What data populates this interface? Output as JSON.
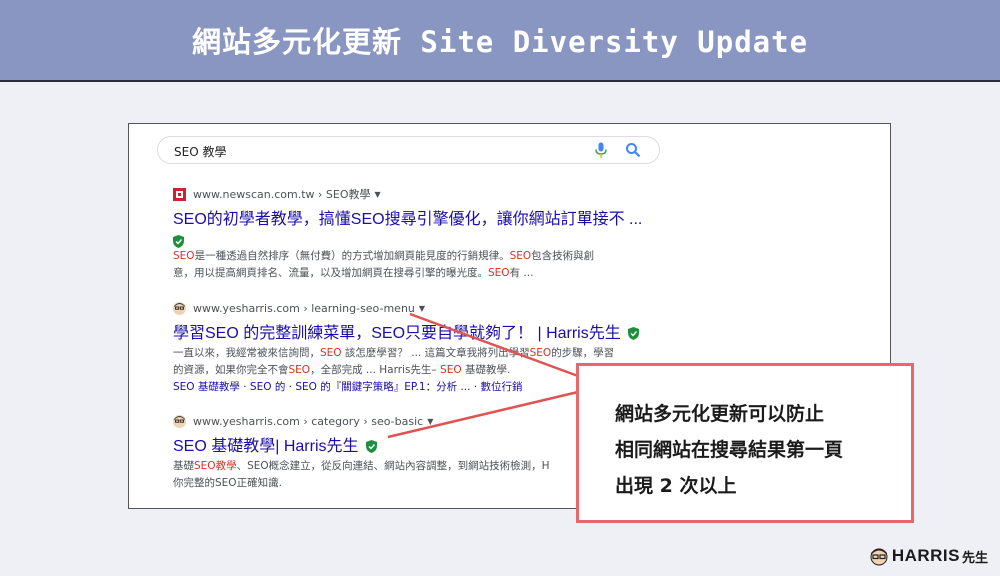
{
  "banner": {
    "title": "網站多元化更新 Site Diversity Update"
  },
  "search": {
    "query": "SEO 教學",
    "mic_icon": "mic-icon",
    "search_icon": "search-icon"
  },
  "results": [
    {
      "cite": "www.newscan.com.tw › SEO教學",
      "title": "SEO的初學者教學，搞懂SEO搜尋引擎優化，讓你網站訂單接不 ...",
      "snippet1_parts": [
        "SEO",
        "是一種透過自然排序（無付費）的方式增加網頁能見度的行銷規律。",
        "SEO",
        "包含技術與創"
      ],
      "snippet2_parts": [
        "意，用以提高網頁排名、流量，以及增加網頁在搜尋引擎的曝光度。",
        "SEO",
        "有 ..."
      ]
    },
    {
      "cite": "www.yesharris.com › learning-seo-menu",
      "title": "學習SEO 的完整訓練菜單，SEO只要自學就夠了！ | Harris先生",
      "snippet1_parts": [
        "一直以來，我經常被來信詢問，",
        "SEO",
        " 該怎麼學習？ ... 這篇文章我將列出學習",
        "SEO",
        "的步驟，學習"
      ],
      "snippet2_parts": [
        "的資源，如果你完全不會",
        "SEO",
        "，全部完成 ... Harris先生– ",
        "SEO",
        " 基礎教學."
      ],
      "sitelinks": "SEO 基礎教學 · SEO 的 · SEO 的『關鍵字策略』EP.1：分析 ... · 數位行銷"
    },
    {
      "cite": "www.yesharris.com › category › seo-basic",
      "title": "SEO 基礎教學| Harris先生",
      "snippet1_parts": [
        "基礎",
        "SEO教學",
        "、SEO概念建立，從反向連結、網站內容調整，到網站技術檢測，H"
      ],
      "snippet2_parts": [
        "你完整的SEO正確知識."
      ]
    }
  ],
  "callout": {
    "lines": [
      "網站多元化更新可以防止",
      "相同網站在搜尋結果第一頁",
      "出現 2 次以上"
    ]
  },
  "brand": {
    "name": "HARRIS",
    "suffix": "先生"
  },
  "colors": {
    "banner": "#8a96c2",
    "link": "#1a0dab",
    "keyword": "#d93025",
    "callout_border": "#e8686a",
    "arrow": "#e05353"
  }
}
